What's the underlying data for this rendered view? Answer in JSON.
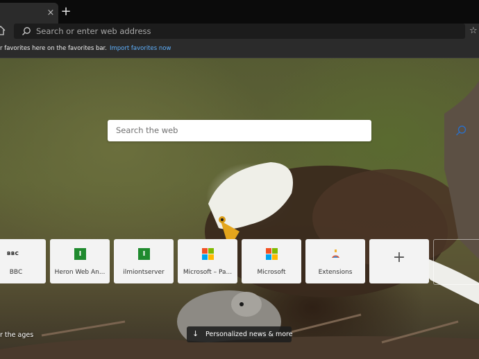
{
  "browser": {
    "new_tab_symbol": "+",
    "tab_close_symbol": "×",
    "address_placeholder": "Search or enter web address",
    "favorites_bar": {
      "message": "r favorites here on the favorites bar.",
      "link": "Import favorites now"
    }
  },
  "newtab": {
    "search_placeholder": "Search the web",
    "tiles": [
      {
        "label": "BBC",
        "icon": "bbc-logo-icon",
        "icon_text": "BBC"
      },
      {
        "label": "Heron Web An...",
        "icon": "green-i-icon",
        "icon_text": "I"
      },
      {
        "label": "ilmiontserver",
        "icon": "green-i-icon",
        "icon_text": "I"
      },
      {
        "label": "Microsoft – Pa...",
        "icon": "microsoft-logo-icon"
      },
      {
        "label": "Microsoft",
        "icon": "microsoft-logo-icon"
      },
      {
        "label": "Extensions",
        "icon": "extensions-icon"
      },
      {
        "label": "",
        "icon": "plus-icon",
        "icon_text": "+"
      }
    ],
    "background_credit": "r the ages",
    "news_button": "Personalized news & more",
    "news_arrow": "↓"
  },
  "colors": {
    "tabstrip": "#0b0b0b",
    "toolbar": "#2b2b2b",
    "link": "#5fb2ff",
    "ms_red": "#f25022",
    "ms_green": "#7fba00",
    "ms_blue": "#00a4ef",
    "ms_yellow": "#ffb900"
  }
}
